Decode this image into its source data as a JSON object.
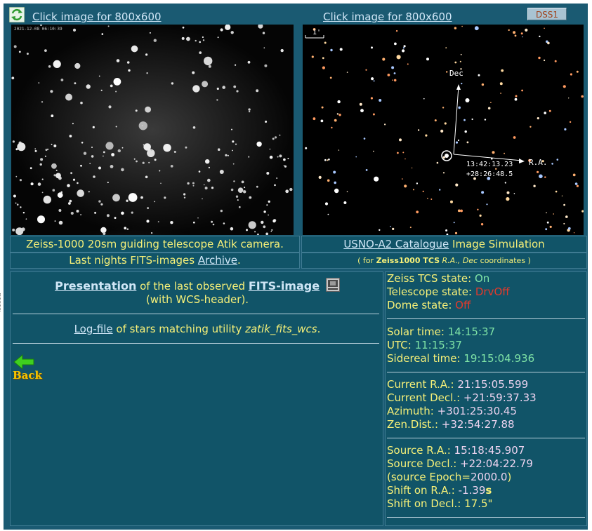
{
  "top_links": {
    "left": "Click image for 800x600",
    "right": "Click image for 800x600"
  },
  "dss_button": "DSS1",
  "left_image": {
    "timestamp": "2021-12-08 06:10:39"
  },
  "right_image": {
    "scale_label": "1'",
    "dec_label": "Dec",
    "ra_label": "R.A.",
    "coord_ra": "13:42:13.23",
    "coord_dec": "+28:26:48.5"
  },
  "captions": {
    "left_line1": "Zeiss-1000 20sm guiding telescope Atik camera.",
    "left_line2_prefix": "Last nights FITS-images ",
    "left_line2_link": "Archive",
    "left_line2_suffix": ".",
    "right_line1_link": "USNO-A2 Catalogue",
    "right_line1_suffix": " Image Simulation",
    "right_line2_a": "( for ",
    "right_line2_b": "Zeiss1000 TCS",
    "right_line2_c": " R.A., Dec",
    "right_line2_d": " coordinates )"
  },
  "main": {
    "presentation_link": "Presentation",
    "presentation_mid": " of the last observed ",
    "fits_link": "FITS-image",
    "wcs_text": "(with WCS-header).",
    "logfile_link": "Log-file",
    "logfile_mid": " of stars matching utility ",
    "logfile_util": "zatik_fits_wcs",
    "logfile_end": ".",
    "back_label": "Back"
  },
  "status": {
    "tcs_label": "Zeiss TCS state:",
    "tcs_value": "On",
    "telescope_label": "Telescope state:",
    "telescope_value": "DrvOff",
    "dome_label": "Dome state:",
    "dome_value": "Off",
    "solar_label": "Solar time:",
    "solar_value": "14:15:37",
    "utc_label": "UTC:",
    "utc_value": "11:15:37",
    "sidereal_label": "Sidereal time:",
    "sidereal_value": "19:15:04.936",
    "cur_ra_label": "Current R.A.:",
    "cur_ra_value": "21:15:05.599",
    "cur_dec_label": "Current Decl.:",
    "cur_dec_value": "+21:59:37.33",
    "az_label": "Azimuth:",
    "az_value": "+301:25:30.45",
    "zen_label": "Zen.Dist.:",
    "zen_value": "+32:54:27.88",
    "src_ra_label": "Source R.A.:",
    "src_ra_value": "15:18:45.907",
    "src_dec_label": "Source Decl.:",
    "src_dec_value": "+22:04:22.79",
    "epoch_open": "(source Epoch=",
    "epoch_value": "2000.0",
    "epoch_close": ")",
    "shift_ra_label": "Shift on R.A.:",
    "shift_ra_value": "-1.39",
    "shift_ra_unit": "s",
    "shift_dec_label": "Shift on Decl.:",
    "shift_dec_value": "17.5\""
  },
  "colors": {
    "panel": "#1a5a72",
    "label": "#f6f078",
    "time": "#7fe3a6",
    "coord": "#ecd3ef",
    "alert": "#e33a2b"
  }
}
